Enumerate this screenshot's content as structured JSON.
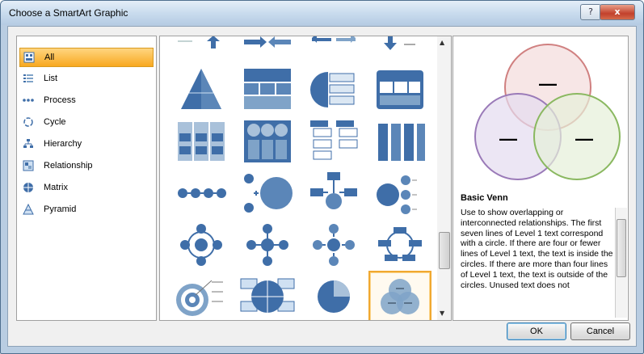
{
  "window": {
    "title": "Choose a SmartArt Graphic",
    "help_label": "?",
    "close_label": "x"
  },
  "categories": [
    {
      "label": "All",
      "icon": "all-icon",
      "selected": true
    },
    {
      "label": "List",
      "icon": "list-icon"
    },
    {
      "label": "Process",
      "icon": "process-icon"
    },
    {
      "label": "Cycle",
      "icon": "cycle-icon"
    },
    {
      "label": "Hierarchy",
      "icon": "hierarchy-icon"
    },
    {
      "label": "Relationship",
      "icon": "relationship-icon"
    },
    {
      "label": "Matrix",
      "icon": "matrix-icon"
    },
    {
      "label": "Pyramid",
      "icon": "pyramid-icon"
    }
  ],
  "gallery": {
    "selected_item": "basic-venn-thumbnail",
    "scroll_up": "▲",
    "scroll_down": "▼"
  },
  "preview": {
    "title": "Basic Venn",
    "description": "Use to show overlapping or interconnected relationships. The first seven lines of Level 1 text correspond with a circle. If there are four or fewer lines of Level 1 text, the text is inside the circles. If there are more than four lines of Level 1 text, the text is outside of the circles. Unused text does not",
    "circle_text": "—"
  },
  "buttons": {
    "ok": "OK",
    "cancel": "Cancel"
  },
  "colors": {
    "accent_blue": "#3f6ea8",
    "selection_orange": "#f8a820",
    "venn_red": "#e08080",
    "venn_purple": "#a080c0",
    "venn_green": "#90c060"
  }
}
